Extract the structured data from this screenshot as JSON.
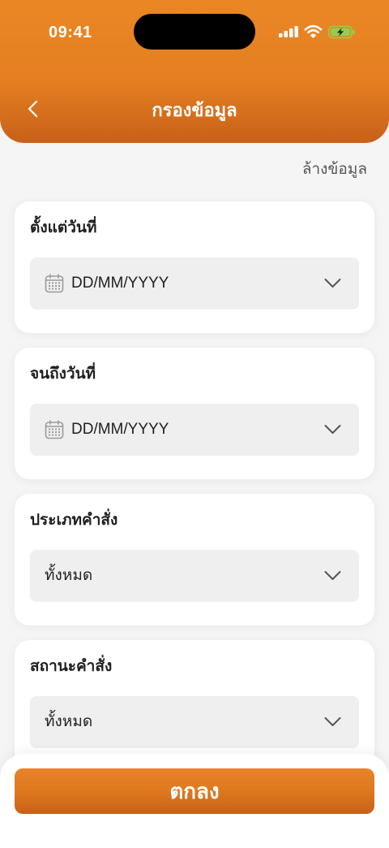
{
  "status_bar": {
    "time": "09:41",
    "signal_icon": "cellular-signal-icon",
    "wifi_icon": "wifi-icon",
    "battery_icon": "battery-charging-icon"
  },
  "header": {
    "title": "กรองข้อมูล",
    "back_icon": "chevron-left-icon"
  },
  "toolbar": {
    "clear_label": "ล้างข้อมูล"
  },
  "filters": [
    {
      "label": "ตั้งแต่วันที่",
      "placeholder": "DD/MM/YYYY",
      "leading_icon": "calendar-icon",
      "dropdown_icon": "chevron-down-icon"
    },
    {
      "label": "จนถึงวันที่",
      "placeholder": "DD/MM/YYYY",
      "leading_icon": "calendar-icon",
      "dropdown_icon": "chevron-down-icon"
    },
    {
      "label": "ประเภทคำสั่ง",
      "value": "ทั้งหมด",
      "dropdown_icon": "chevron-down-icon"
    },
    {
      "label": "สถานะคำสั่ง",
      "value": "ทั้งหมด",
      "dropdown_icon": "chevron-down-icon"
    }
  ],
  "footer": {
    "confirm_label": "ตกลง"
  },
  "colors": {
    "accent_top": "#ea8725",
    "accent": "#e07a1f",
    "accent_dark": "#c8611a",
    "background": "#f5f5f5",
    "field": "#efefef",
    "battery": "#8fd14f"
  }
}
